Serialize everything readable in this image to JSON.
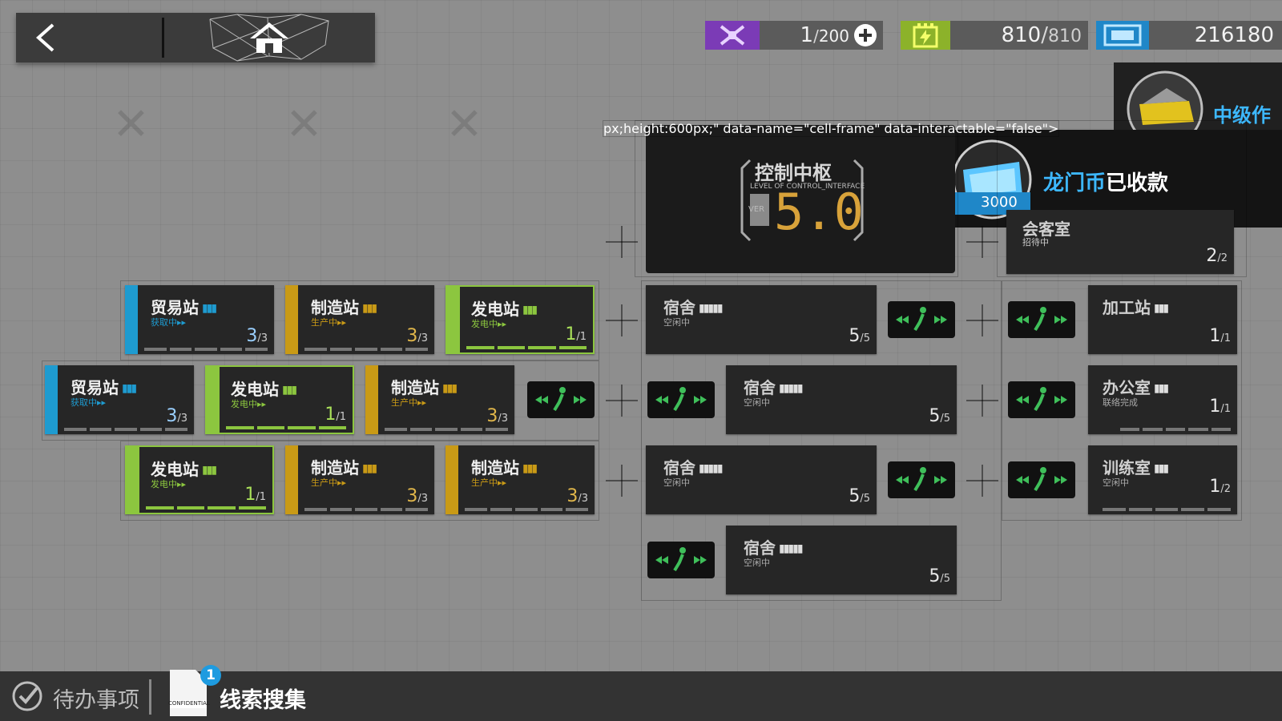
{
  "resources": {
    "drone": {
      "icon": "drone-icon",
      "current": "1",
      "max": "200"
    },
    "power": {
      "icon": "battery-icon",
      "current": "810",
      "max": "810"
    },
    "lmd": {
      "icon": "lmd-icon",
      "value": "216180"
    }
  },
  "notifications": {
    "top": {
      "text": "中级作"
    },
    "main": {
      "prefix": "龙门币",
      "suffix": "已收款",
      "amount": "3000"
    }
  },
  "control_center": {
    "name": "控制中枢",
    "subtitle": "LEVEL OF CONTROL_INTERFACE",
    "ver": "VER",
    "level": "5.0"
  },
  "reception": {
    "name": "会客室",
    "status": "招待中",
    "count": "2",
    "max": "2"
  },
  "rooms": {
    "r1": {
      "name": "贸易站",
      "status": "获取中▸▸",
      "count": "3",
      "max": "3"
    },
    "r2": {
      "name": "制造站",
      "status": "生产中▸▸",
      "count": "3",
      "max": "3"
    },
    "r3": {
      "name": "发电站",
      "status": "发电中▸▸",
      "count": "1",
      "max": "1"
    },
    "r4": {
      "name": "贸易站",
      "status": "获取中▸▸",
      "count": "3",
      "max": "3"
    },
    "r5": {
      "name": "发电站",
      "status": "发电中▸▸",
      "count": "1",
      "max": "1"
    },
    "r6": {
      "name": "制造站",
      "status": "生产中▸▸",
      "count": "3",
      "max": "3"
    },
    "r7": {
      "name": "发电站",
      "status": "发电中▸▸",
      "count": "1",
      "max": "1"
    },
    "r8": {
      "name": "制造站",
      "status": "生产中▸▸",
      "count": "3",
      "max": "3"
    },
    "r9": {
      "name": "制造站",
      "status": "生产中▸▸",
      "count": "3",
      "max": "3"
    }
  },
  "dorms": {
    "d1": {
      "name": "宿舍",
      "status": "空闲中",
      "count": "5",
      "max": "5"
    },
    "d2": {
      "name": "宿舍",
      "status": "空闲中",
      "count": "5",
      "max": "5"
    },
    "d3": {
      "name": "宿舍",
      "status": "空闲中",
      "count": "5",
      "max": "5"
    },
    "d4": {
      "name": "宿舍",
      "status": "空闲中",
      "count": "5",
      "max": "5"
    }
  },
  "right_rooms": {
    "workshop": {
      "name": "加工站",
      "status": "",
      "count": "1",
      "max": "1"
    },
    "office": {
      "name": "办公室",
      "status": "联络完成",
      "count": "1",
      "max": "1"
    },
    "training": {
      "name": "训练室",
      "status": "空闲中",
      "count": "1",
      "max": "2"
    }
  },
  "bottom": {
    "todo": "待办事项",
    "clue": "线索搜集",
    "clue_badge": "1",
    "doc_label": "CONFIDENTIAL"
  },
  "colors": {
    "trade": "#1e9bd0",
    "factory": "#c99a16",
    "power": "#8cc63f",
    "accent": "#3db8ff"
  }
}
